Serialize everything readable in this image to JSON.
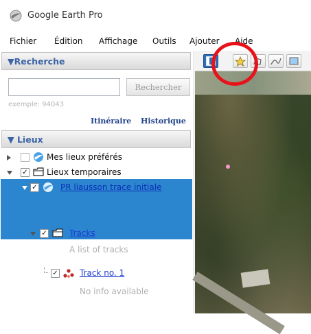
{
  "window": {
    "title": "Google Earth Pro",
    "icon": "google-earth-icon"
  },
  "menu": [
    "Fichier",
    "Édition",
    "Affichage",
    "Outils",
    "Ajouter",
    "Aide"
  ],
  "search": {
    "header": "▼Recherche",
    "input_value": "",
    "button": "Rechercher",
    "hint": "exemple: 94043",
    "links": [
      "Itinéraire",
      "Historique"
    ]
  },
  "places": {
    "header": "▼ Lieux",
    "items": [
      {
        "label": "Mes lieux préférés",
        "checked": false,
        "expanded": false
      },
      {
        "label": "Lieux temporaires",
        "checked": true,
        "expanded": true
      },
      {
        "label": "PR liausson trace initiale",
        "checked": true,
        "expanded": true,
        "selected": true
      },
      {
        "label": "Tracks",
        "checked": true,
        "expanded": true,
        "description": "A list of tracks"
      },
      {
        "label": "Track no. 1",
        "checked": true,
        "description": "No info available"
      }
    ]
  },
  "toolbar": {
    "highlighted_tool": "add-placemark-icon"
  },
  "colors": {
    "selection": "#2b86cf",
    "link": "#1a3bd1",
    "header_text": "#3a64a6",
    "highlight_circle": "#e8121a"
  }
}
